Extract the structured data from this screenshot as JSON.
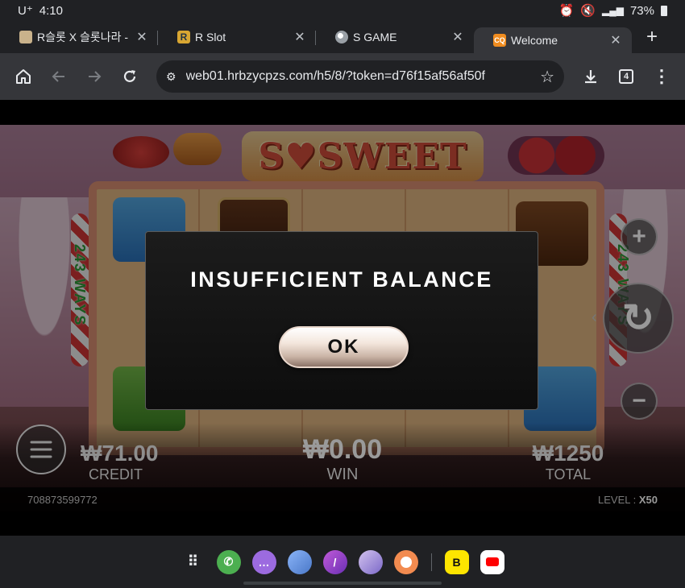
{
  "status_bar": {
    "carrier": "U⁺",
    "time": "4:10",
    "battery": "73%"
  },
  "tabs": [
    {
      "title": "R슬롯 X 슬롯나라 - 보",
      "icon": "book-favicon",
      "active": false
    },
    {
      "title": "R Slot",
      "icon": "r-slot-favicon",
      "active": false
    },
    {
      "title": "S GAME",
      "icon": "globe-favicon",
      "active": false
    },
    {
      "title": "Welcome",
      "icon": "cq-favicon",
      "active": true
    }
  ],
  "toolbar": {
    "url": "web01.hrbzycpzs.com/h5/8/?token=d76f15af56af50f",
    "tab_count": "4"
  },
  "game": {
    "logo": "S♥SWEET",
    "ways_label": "243 WAYS",
    "credit_amount": "₩71.00",
    "credit_label": "CREDIT",
    "win_amount": "₩0.00",
    "win_label": "WIN",
    "total_amount": "₩1250",
    "total_label": "TOTAL",
    "round_id": "708873599772",
    "level_label": "LEVEL",
    "level_value": "X50"
  },
  "modal": {
    "title": "INSUFFICIENT BALANCE",
    "ok_label": "OK"
  },
  "dock": {
    "apps": [
      "apps-grid-icon",
      "phone-icon",
      "messages-icon",
      "gallery-icon",
      "notes-icon",
      "internet-icon",
      "camera-icon",
      "kakao-icon",
      "youtube-icon"
    ]
  },
  "colors": {
    "chrome_bg": "#202124",
    "toolbar_bg": "#35363a",
    "modal_bg": "#141414",
    "ok_button": "#f3e6dc"
  }
}
